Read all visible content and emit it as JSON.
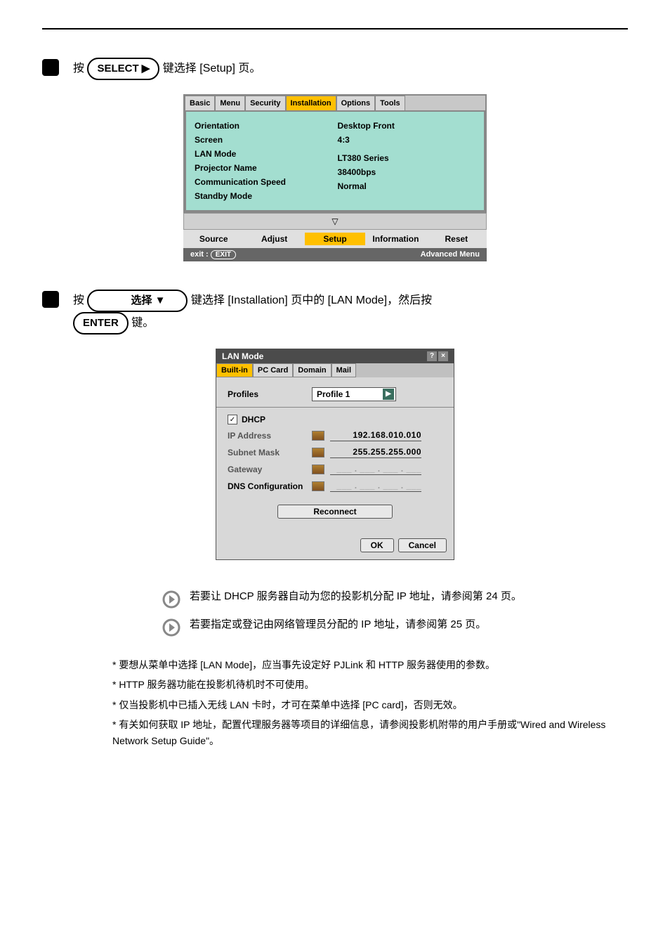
{
  "step4": {
    "prefix": "按 ",
    "key_label": "SELECT ▶",
    "suffix": " 键选择 [Setup] 页。"
  },
  "setup_screen": {
    "tabs": [
      "Basic",
      "Menu",
      "Security",
      "Installation",
      "Options",
      "Tools"
    ],
    "active_tab": "Installation",
    "rows_left": [
      "Orientation",
      "Screen",
      "LAN Mode",
      "Projector Name",
      "Communication Speed",
      "Standby Mode"
    ],
    "rows_right": [
      "Desktop Front",
      "4:3",
      "",
      "LT380 Series",
      "38400bps",
      "Normal"
    ],
    "menubar": [
      "Source",
      "Adjust",
      "Setup",
      "Information",
      "Reset"
    ],
    "menubar_active": "Setup",
    "footer_left_label": "exit :",
    "footer_left_pill": "EXIT",
    "footer_right": "Advanced Menu"
  },
  "step5": {
    "line1_prefix": "按 ",
    "key1": "选择 ▼",
    "line1_suffix": " 键选择 [Installation] 页中的 [LAN Mode]，然后按",
    "key2": "ENTER",
    "line2_suffix": " 键。"
  },
  "lan_dialog": {
    "title": "LAN Mode",
    "tabs": [
      "Built-in",
      "PC Card",
      "Domain",
      "Mail"
    ],
    "active_tab": "Built-in",
    "profiles_label": "Profiles",
    "profiles_value": "Profile 1",
    "dhcp_label": "DHCP",
    "ip_label": "IP Address",
    "ip_value": "192.168.010.010",
    "subnet_label": "Subnet Mask",
    "subnet_value": "255.255.255.000",
    "gateway_label": "Gateway",
    "gateway_value": "___ . ___ . ___ . ___",
    "dns_label": "DNS Configuration",
    "dns_value": "___ . ___ . ___ . ___",
    "reconnect": "Reconnect",
    "ok": "OK",
    "cancel": "Cancel"
  },
  "instructions": {
    "a": "若要让 DHCP 服务器自动为您的投影机分配 IP 地址，请参阅第 24 页。",
    "b": "若要指定或登记由网络管理员分配的 IP 地址，请参阅第 25 页。"
  },
  "notes": {
    "line1": "* 要想从菜单中选择 [LAN Mode]，应当事先设定好 PJLink 和 HTTP 服务器使用的参数。",
    "line2": "* HTTP 服务器功能在投影机待机时不可使用。",
    "line3": "* 仅当投影机中已插入无线 LAN 卡时，才可在菜单中选择 [PC card]，否则无效。",
    "line4": "* 有关如何获取 IP 地址，配置代理服务器等项目的详细信息，请参阅投影机附带的用户手册或\"Wired and Wireless Network Setup Guide\"。"
  }
}
